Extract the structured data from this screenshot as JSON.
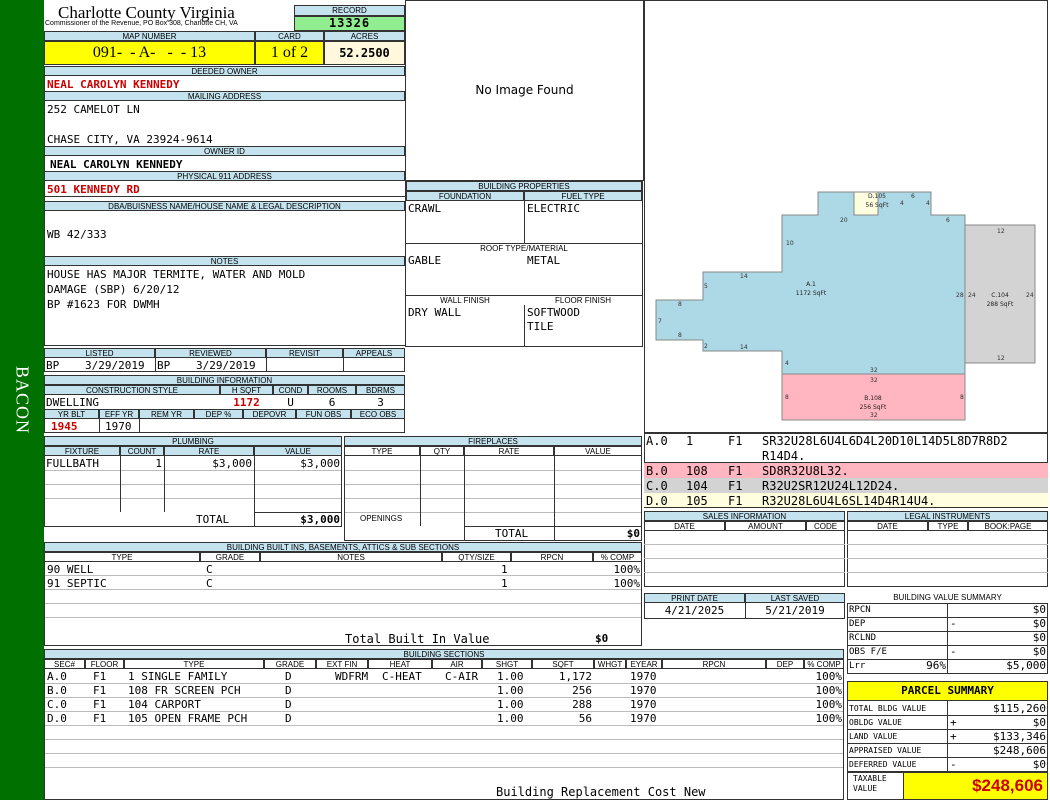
{
  "sidebar": {
    "label": "BACON"
  },
  "county": {
    "title": "Charlotte County Virginia",
    "subtitle": "Commissioner of the Revenue, PO Box 308, Charlotte CH, VA"
  },
  "record": {
    "label": "RECORD",
    "value": "13326"
  },
  "map_number": {
    "label": "MAP NUMBER",
    "value": "091-  - A-   -  - 13"
  },
  "card": {
    "label": "CARD",
    "value": "1 of 2"
  },
  "acres": {
    "label": "ACRES",
    "value": "52.2500"
  },
  "deeded_owner": {
    "label": "DEEDED OWNER",
    "value": "NEAL CAROLYN KENNEDY"
  },
  "mailing_address": {
    "label": "MAILING ADDRESS",
    "line1": "252 CAMELOT LN",
    "line2": "CHASE CITY, VA 23924-9614"
  },
  "owner_id": {
    "label": "OWNER ID",
    "value": "NEAL CAROLYN KENNEDY"
  },
  "physical_address": {
    "label": "PHYSICAL 911 ADDRESS",
    "value": "501 KENNEDY RD"
  },
  "legal": {
    "label": "DBA/BUISNESS NAME/HOUSE NAME & LEGAL DESCRIPTION",
    "value": "WB 42/333"
  },
  "notes": {
    "label": "NOTES",
    "lines": [
      "HOUSE HAS MAJOR TERMITE, WATER AND MOLD",
      "DAMAGE (SBP) 6/20/12",
      "BP #1623 FOR DWMH"
    ]
  },
  "photo": {
    "text": "No Image Found"
  },
  "building_properties": {
    "label": "BUILDING PROPERTIES",
    "foundation_label": "FOUNDATION",
    "foundation": "CRAWL",
    "fuel_label": "FUEL TYPE",
    "fuel": "ELECTRIC",
    "roof_label": "ROOF TYPE/MATERIAL",
    "roof_type": "GABLE",
    "roof_material": "METAL",
    "wall_label": "WALL FINISH",
    "wall": "DRY WALL",
    "floor_label": "FLOOR FINISH",
    "floor1": "SOFTWOOD",
    "floor2": "TILE"
  },
  "dates": {
    "listed_label": "LISTED",
    "listed_code": "BP",
    "listed": "3/29/2019",
    "reviewed_label": "REVIEWED",
    "reviewed_code": "BP",
    "reviewed": "3/29/2019",
    "revisit_label": "REVISIT",
    "appeals_label": "APPEALS"
  },
  "building_info": {
    "label": "BUILDING INFORMATION",
    "style_label": "CONSTRUCTION STYLE",
    "style": "DWELLING",
    "hsqft_label": "H SQFT",
    "hsqft": "1172",
    "cond_label": "COND",
    "cond": "U",
    "rooms_label": "ROOMS",
    "rooms": "6",
    "bdrms_label": "BDRMS",
    "bdrms": "3",
    "yrblt_label": "YR BLT",
    "yrblt": "1945",
    "effyr_label": "EFF YR",
    "effyr": "1970",
    "remyr_label": "REM YR",
    "dep_label": "DEP %",
    "depovr_label": "DEPOVR",
    "funobs_label": "FUN OBS",
    "ecoobs_label": "ECO OBS"
  },
  "plumbing": {
    "label": "PLUMBING",
    "headers": [
      "FIXTURE",
      "COUNT",
      "RATE",
      "VALUE"
    ],
    "rows": [
      {
        "fixture": "FULLBATH",
        "count": "1",
        "rate": "$3,000",
        "value": "$3,000"
      }
    ],
    "total_label": "TOTAL",
    "total": "$3,000"
  },
  "fireplaces": {
    "label": "FIREPLACES",
    "headers": [
      "TYPE",
      "QTY",
      "RATE",
      "VALUE"
    ],
    "openings_label": "OPENINGS",
    "total_label": "TOTAL",
    "total": "$0"
  },
  "sketch": {
    "labels": [
      {
        "id": "D.105",
        "area": "56 SqFt"
      },
      {
        "id": "A.1",
        "area": "1172 SqFt"
      },
      {
        "id": "C.104",
        "area": "288 SqFt"
      },
      {
        "id": "B.108",
        "area": "256 SqFt"
      }
    ],
    "dims": [
      "20",
      "6",
      "4",
      "4",
      "6",
      "10",
      "14",
      "5",
      "8",
      "7",
      "8",
      "2",
      "14",
      "4",
      "32",
      "28",
      "24",
      "24",
      "12",
      "12",
      "32",
      "8",
      "8",
      "32"
    ],
    "colors": {
      "a": "#add8e6",
      "b": "#ffb6c1",
      "c": "#d3d3d3",
      "d": "#ffffe0"
    }
  },
  "sketch_legend": [
    {
      "sec": "A.0",
      "num": "1",
      "floor": "F1",
      "code": "SR32U28L6U4L6D4L20D10L14D5L8D7R8D2",
      "code2": "R14D4.",
      "color": "#fff"
    },
    {
      "sec": "B.0",
      "num": "108",
      "floor": "F1",
      "code": "SD8R32U8L32.",
      "color": "#ffb6c1"
    },
    {
      "sec": "C.0",
      "num": "104",
      "floor": "F1",
      "code": "R32U2SR12U24L12D24.",
      "color": "#d3d3d3"
    },
    {
      "sec": "D.0",
      "num": "105",
      "floor": "F1",
      "code": "R32U28L6U4L6SL14D4R14U4.",
      "color": "#ffffe0"
    }
  ],
  "sales": {
    "label": "SALES INFORMATION",
    "headers": [
      "DATE",
      "AMOUNT",
      "CODE"
    ]
  },
  "legal_instruments": {
    "label": "LEGAL INSTRUMENTS",
    "headers": [
      "DATE",
      "TYPE",
      "BOOK:PAGE"
    ]
  },
  "print_date": {
    "label": "PRINT DATE",
    "value": "4/21/2025"
  },
  "last_saved": {
    "label": "LAST SAVED",
    "value": "5/21/2019"
  },
  "value_summary": {
    "label": "BUILDING VALUE SUMMARY",
    "rows": [
      {
        "label": "RPCN",
        "sign": "",
        "pct": "",
        "value": "$0"
      },
      {
        "label": "DEP",
        "sign": "-",
        "pct": "",
        "value": "$0"
      },
      {
        "label": "RCLND",
        "sign": "",
        "pct": "",
        "value": "$0"
      },
      {
        "label": "OBS F/E",
        "sign": "-",
        "pct": "",
        "value": "$0"
      },
      {
        "label": "Lrr",
        "sign": "",
        "pct": "96%",
        "value": "$5,000"
      }
    ]
  },
  "builtins": {
    "label": "BUILDING BUILT INS, BASEMENTS, ATTICS & SUB SECTIONS",
    "headers": [
      "TYPE",
      "GRADE",
      "NOTES",
      "QTY/SIZE",
      "RPCN",
      "% COMP"
    ],
    "rows": [
      {
        "type": "90 WELL",
        "grade": "C",
        "qty": "1",
        "comp": "100%"
      },
      {
        "type": "91 SEPTIC",
        "grade": "C",
        "qty": "1",
        "comp": "100%"
      }
    ],
    "total_label": "Total Built In Value",
    "total": "$0"
  },
  "parcel": {
    "label": "PARCEL SUMMARY",
    "rows": [
      {
        "label": "TOTAL BLDG VALUE",
        "sign": "",
        "value": "$115,260"
      },
      {
        "label": "OBLDG VALUE",
        "sign": "+",
        "value": "$0"
      },
      {
        "label": "LAND VALUE",
        "sign": "+",
        "value": "$133,346"
      },
      {
        "label": "APPRAISED VALUE",
        "sign": "",
        "value": "$248,606"
      },
      {
        "label": "DEFERRED VALUE",
        "sign": "-",
        "value": "$0"
      }
    ],
    "taxable_label": "TAXABLE VALUE",
    "taxable": "$248,606"
  },
  "sections": {
    "label": "BUILDING SECTIONS",
    "headers": [
      "SEC#",
      "FLOOR",
      "TYPE",
      "GRADE",
      "EXT FIN",
      "HEAT",
      "AIR",
      "SHGT",
      "SQFT",
      "WHGT",
      "EYEAR",
      "RPCN",
      "DEP",
      "% COMP"
    ],
    "rows": [
      {
        "sec": "A.0",
        "floor": "F1",
        "type": "1 SINGLE FAMILY",
        "grade": "D",
        "ext": "WDFRM",
        "heat": "C-HEAT",
        "air": "C-AIR",
        "shgt": "1.00",
        "sqft": "1,172",
        "eyear": "1970",
        "comp": "100%"
      },
      {
        "sec": "B.0",
        "floor": "F1",
        "type": "108 FR SCREEN PCH",
        "grade": "D",
        "ext": "",
        "heat": "",
        "air": "",
        "shgt": "1.00",
        "sqft": "256",
        "eyear": "1970",
        "comp": "100%"
      },
      {
        "sec": "C.0",
        "floor": "F1",
        "type": "104 CARPORT",
        "grade": "D",
        "ext": "",
        "heat": "",
        "air": "",
        "shgt": "1.00",
        "sqft": "288",
        "eyear": "1970",
        "comp": "100%"
      },
      {
        "sec": "D.0",
        "floor": "F1",
        "type": "105 OPEN FRAME PCH",
        "grade": "D",
        "ext": "",
        "heat": "",
        "air": "",
        "shgt": "1.00",
        "sqft": "56",
        "eyear": "1970",
        "comp": "100%"
      }
    ],
    "footer": "Building Replacement Cost New"
  }
}
